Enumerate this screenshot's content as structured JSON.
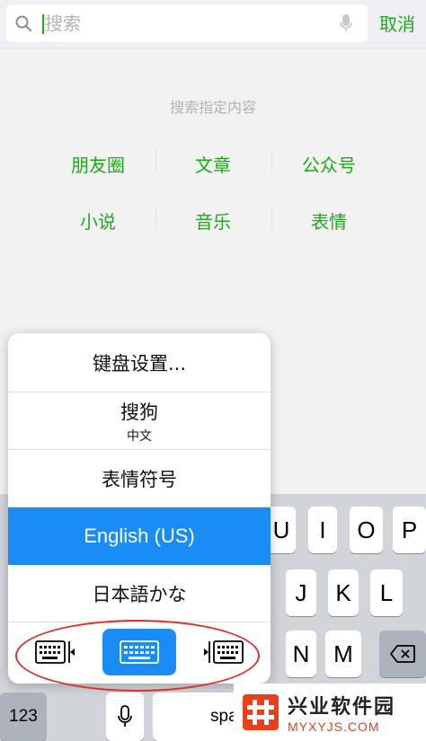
{
  "search": {
    "placeholder": "搜索",
    "cancel_label": "取消"
  },
  "hint": "搜索指定内容",
  "categories": [
    {
      "label": "朋友圈"
    },
    {
      "label": "文章"
    },
    {
      "label": "公众号"
    },
    {
      "label": "小说"
    },
    {
      "label": "音乐"
    },
    {
      "label": "表情"
    }
  ],
  "keyboard": {
    "keys": {
      "U": "U",
      "I": "I",
      "O": "O",
      "P": "P",
      "J": "J",
      "K": "K",
      "L": "L",
      "N": "N",
      "M": "M"
    },
    "numbers_label": "123",
    "space_label_visible": "spa"
  },
  "language_menu": {
    "items": [
      {
        "main": "键盘设置...",
        "sub": ""
      },
      {
        "main": "搜狗",
        "sub": "中文"
      },
      {
        "main": "表情符号",
        "sub": ""
      },
      {
        "main": "English (US)",
        "sub": "",
        "selected": true
      },
      {
        "main": "日本語かな",
        "sub": ""
      }
    ],
    "modes": [
      "keyboard-left-icon",
      "keyboard-full-icon",
      "keyboard-right-icon"
    ],
    "active_mode": "keyboard-full-icon"
  },
  "watermark": {
    "cn": "兴业软件园",
    "en": "MYXYJS.COM"
  },
  "colors": {
    "accent_green": "#1aad19",
    "selected_blue": "#1a8cf5",
    "annotation_red": "#d9322c",
    "watermark_orange": "#e8401a"
  }
}
